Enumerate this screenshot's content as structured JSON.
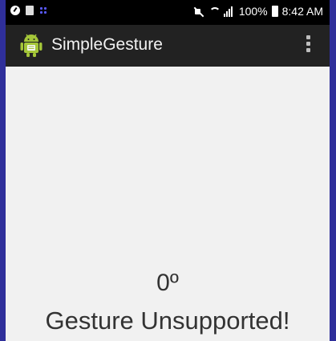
{
  "status_bar": {
    "battery": "100%",
    "time": "8:42 AM"
  },
  "app_bar": {
    "title": "SimpleGesture",
    "app_icon": "android-robot-icon",
    "overflow_icon": "more-vert-icon"
  },
  "main": {
    "angle": "0º",
    "gesture_status": "Gesture Unsupported!"
  },
  "colors": {
    "status_bar_bg": "#000000",
    "app_bar_bg": "#222222",
    "content_bg": "#f1f1f1",
    "frame": "#2f2f9a",
    "android_green": "#a4c639"
  }
}
